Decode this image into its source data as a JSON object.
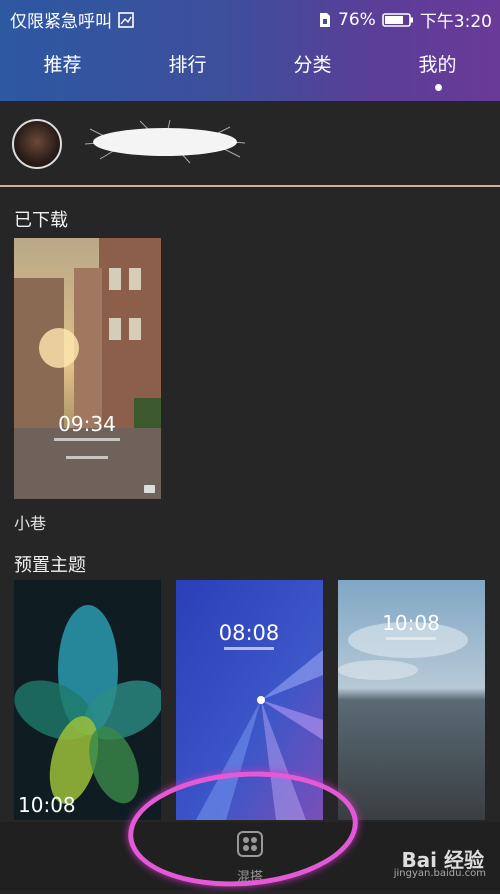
{
  "status_bar": {
    "carrier": "仅限紧急呼叫",
    "battery": "76%",
    "time": "下午3:20"
  },
  "tabs": [
    {
      "label": "推荐"
    },
    {
      "label": "排行"
    },
    {
      "label": "分类"
    },
    {
      "label": "我的",
      "active": true
    }
  ],
  "downloaded": {
    "title": "已下载",
    "items": [
      {
        "name": "小巷",
        "lock_time": "09:34"
      }
    ]
  },
  "preset": {
    "title": "预置主题",
    "items": [
      {
        "lock_time": "10:08"
      },
      {
        "lock_time": "08:08"
      },
      {
        "lock_time": "10:08"
      }
    ]
  },
  "bottom_bar": {
    "label": "混搭"
  },
  "watermark": {
    "brand": "Bai 经验",
    "url": "jingyan.baidu.com"
  },
  "colors": {
    "header_start": "#2d58a2",
    "header_end": "#6a3a98",
    "background": "#262626",
    "annotation": "#e45ad6"
  }
}
